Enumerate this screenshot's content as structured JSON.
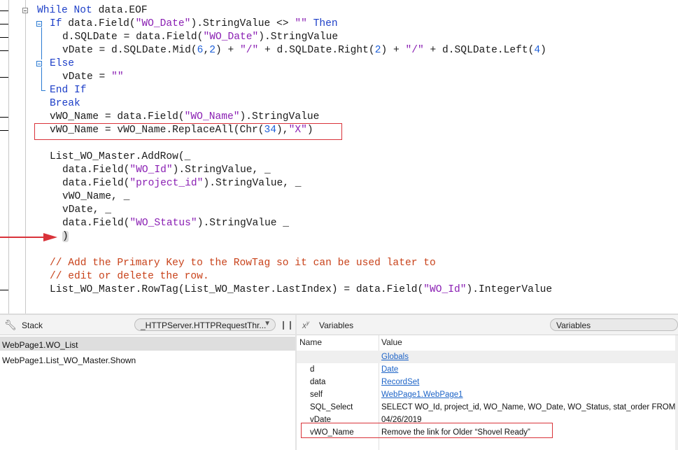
{
  "editor": {
    "lines": [
      {
        "id": "l1",
        "indent": 0,
        "tokens": [
          {
            "t": "While Not",
            "c": "kw"
          },
          {
            "t": " data.EOF",
            "c": ""
          }
        ]
      },
      {
        "id": "l2",
        "indent": 1,
        "tokens": [
          {
            "t": "If",
            "c": "kw"
          },
          {
            "t": " data.Field(",
            "c": ""
          },
          {
            "t": "\"WO_Date\"",
            "c": "str"
          },
          {
            "t": ").StringValue <> ",
            "c": ""
          },
          {
            "t": "\"\"",
            "c": "str"
          },
          {
            "t": " Then",
            "c": "kw"
          }
        ]
      },
      {
        "id": "l3",
        "indent": 2,
        "tokens": [
          {
            "t": "d.SQLDate = data.Field(",
            "c": ""
          },
          {
            "t": "\"WO_Date\"",
            "c": "str"
          },
          {
            "t": ").StringValue",
            "c": ""
          }
        ]
      },
      {
        "id": "l4",
        "indent": 2,
        "tokens": [
          {
            "t": "vDate = d.SQLDate.Mid(",
            "c": ""
          },
          {
            "t": "6",
            "c": "num"
          },
          {
            "t": ",",
            "c": ""
          },
          {
            "t": "2",
            "c": "num"
          },
          {
            "t": ") + ",
            "c": ""
          },
          {
            "t": "\"/\"",
            "c": "str"
          },
          {
            "t": " + d.SQLDate.Right(",
            "c": ""
          },
          {
            "t": "2",
            "c": "num"
          },
          {
            "t": ") + ",
            "c": ""
          },
          {
            "t": "\"/\"",
            "c": "str"
          },
          {
            "t": " + d.SQLDate.Left(",
            "c": ""
          },
          {
            "t": "4",
            "c": "num"
          },
          {
            "t": ")",
            "c": ""
          }
        ]
      },
      {
        "id": "l5",
        "indent": 1,
        "tokens": [
          {
            "t": "Else",
            "c": "kw"
          }
        ]
      },
      {
        "id": "l6",
        "indent": 2,
        "tokens": [
          {
            "t": "vDate = ",
            "c": ""
          },
          {
            "t": "\"\"",
            "c": "str"
          }
        ]
      },
      {
        "id": "l7",
        "indent": 1,
        "tokens": [
          {
            "t": "End If",
            "c": "kw"
          }
        ]
      },
      {
        "id": "l8",
        "indent": 1,
        "tokens": [
          {
            "t": "Break",
            "c": "kw"
          }
        ]
      },
      {
        "id": "l9",
        "indent": 1,
        "tokens": [
          {
            "t": "vWO_Name = data.Field(",
            "c": ""
          },
          {
            "t": "\"WO_Name\"",
            "c": "str"
          },
          {
            "t": ").StringValue",
            "c": ""
          }
        ]
      },
      {
        "id": "l10",
        "indent": 1,
        "tokens": [
          {
            "t": "vWO_Name = vWO_Name.ReplaceAll(Chr(",
            "c": ""
          },
          {
            "t": "34",
            "c": "num"
          },
          {
            "t": "),",
            "c": ""
          },
          {
            "t": "\"X\"",
            "c": "str"
          },
          {
            "t": ")",
            "c": ""
          }
        ]
      },
      {
        "id": "l11",
        "indent": 1,
        "tokens": []
      },
      {
        "id": "l12",
        "indent": 1,
        "tokens": [
          {
            "t": "List_WO_Master.AddRow(_",
            "c": ""
          }
        ]
      },
      {
        "id": "l13",
        "indent": 2,
        "tokens": [
          {
            "t": "data.Field(",
            "c": ""
          },
          {
            "t": "\"WO_Id\"",
            "c": "str"
          },
          {
            "t": ").StringValue, _",
            "c": ""
          }
        ]
      },
      {
        "id": "l14",
        "indent": 2,
        "tokens": [
          {
            "t": "data.Field(",
            "c": ""
          },
          {
            "t": "\"project_id\"",
            "c": "str"
          },
          {
            "t": ").StringValue, _",
            "c": ""
          }
        ]
      },
      {
        "id": "l15",
        "indent": 2,
        "tokens": [
          {
            "t": "vWO_Name, _",
            "c": ""
          }
        ]
      },
      {
        "id": "l16",
        "indent": 2,
        "tokens": [
          {
            "t": "vDate, _",
            "c": ""
          }
        ]
      },
      {
        "id": "l17",
        "indent": 2,
        "tokens": [
          {
            "t": "data.Field(",
            "c": ""
          },
          {
            "t": "\"WO_Status\"",
            "c": "str"
          },
          {
            "t": ").StringValue _",
            "c": ""
          }
        ]
      },
      {
        "id": "l18",
        "indent": 2,
        "tokens": [
          {
            "t": ")",
            "c": "paren"
          }
        ]
      },
      {
        "id": "l19",
        "indent": 1,
        "tokens": []
      },
      {
        "id": "l20",
        "indent": 1,
        "tokens": [
          {
            "t": "// Add the Primary Key to the RowTag so it can be used later to",
            "c": "cm"
          }
        ]
      },
      {
        "id": "l21",
        "indent": 1,
        "tokens": [
          {
            "t": "// edit or delete the row.",
            "c": "cm"
          }
        ]
      },
      {
        "id": "l22",
        "indent": 1,
        "tokens": [
          {
            "t": "List_WO_Master.RowTag(List_WO_Master.LastIndex) = data.Field(",
            "c": ""
          },
          {
            "t": "\"WO_Id\"",
            "c": "str"
          },
          {
            "t": ").IntegerValue",
            "c": ""
          }
        ]
      }
    ]
  },
  "stack_pane": {
    "title": "Stack",
    "thread_dropdown": "_HTTPServer.HTTPRequestThr...",
    "frames": [
      "WebPage1.WO_List",
      "WebPage1.List_WO_Master.Shown"
    ]
  },
  "variables_pane": {
    "title": "Variables",
    "scope_dropdown": "Variables",
    "col_name": "Name",
    "col_value": "Value",
    "globals_label": "Globals",
    "rows": [
      {
        "name": "d",
        "value": "Date",
        "link": true
      },
      {
        "name": "data",
        "value": "RecordSet",
        "link": true
      },
      {
        "name": "self",
        "value": "WebPage1.WebPage1",
        "link": true
      },
      {
        "name": "SQL_Select",
        "value": "SELECT WO_Id, project_id, WO_Name, WO_Date, WO_Status, stat_order FROM...",
        "link": false
      },
      {
        "name": "vDate",
        "value": "04/26/2019",
        "link": false
      },
      {
        "name": "vWO_Name",
        "value": "Remove the link for Older “Shovel Ready”",
        "link": false
      }
    ]
  },
  "colors": {
    "highlight_box": "#d9333a",
    "keyword": "#1d3fc8",
    "string": "#8a1fb3",
    "comment": "#c8421a"
  }
}
